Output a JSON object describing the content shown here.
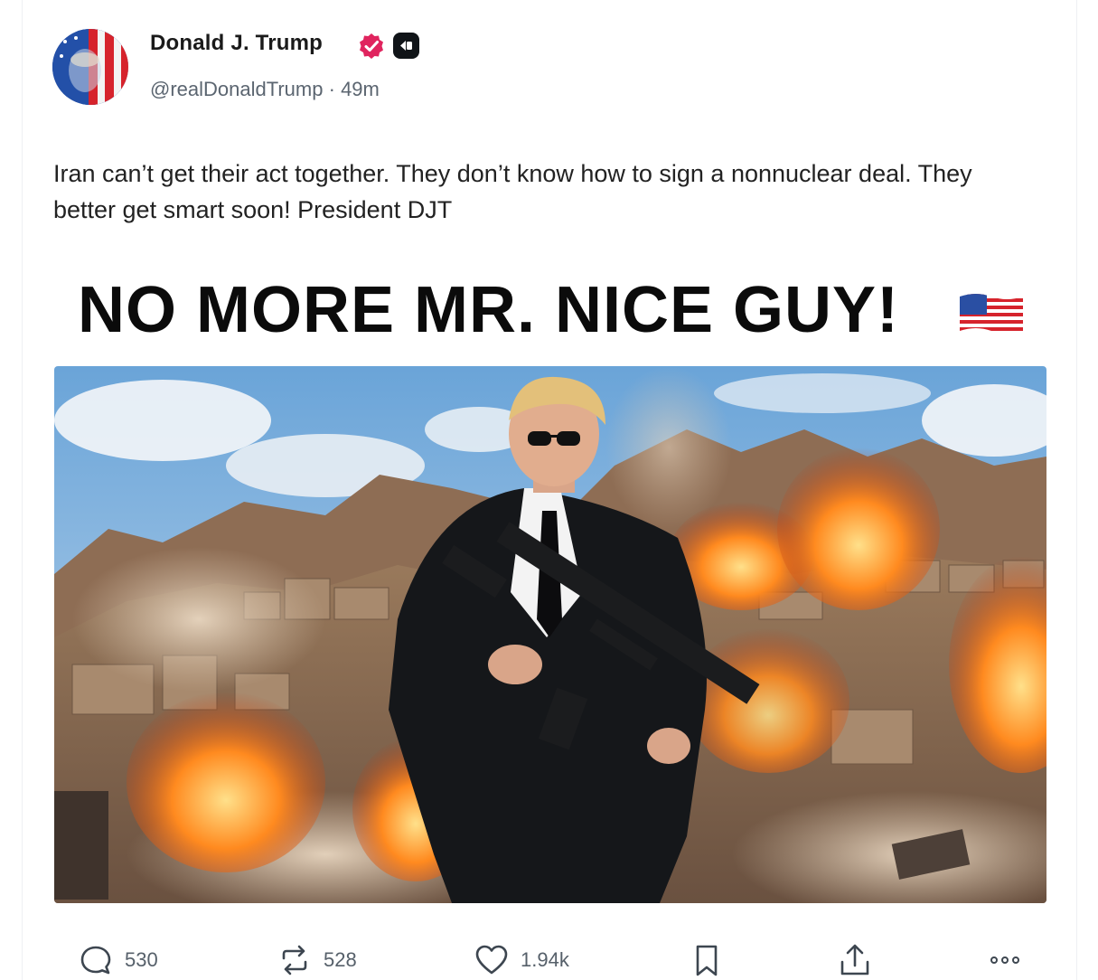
{
  "post": {
    "author_name": "Donald J. Trump",
    "handle": "@realDonaldTrump",
    "separator": "·",
    "time_ago": "49m",
    "body": "Iran can’t get their act together. They don’t know how to sign a nonnuclear deal. They better get smart soon! President DJT",
    "image_headline": "NO MORE MR. NICE GUY!",
    "image_flag_icon": "us-flag-icon",
    "verified_icon": "verified-check-icon",
    "verified_color": "#e0245e",
    "app_badge_icon": "app-badge-icon"
  },
  "actions": {
    "reply": {
      "icon": "reply-icon",
      "count": "530"
    },
    "retruth": {
      "icon": "repost-icon",
      "count": "528"
    },
    "like": {
      "icon": "heart-icon",
      "count": "1.94k"
    },
    "bookmark": {
      "icon": "bookmark-icon"
    },
    "share": {
      "icon": "share-icon"
    },
    "more": {
      "icon": "more-icon"
    }
  }
}
